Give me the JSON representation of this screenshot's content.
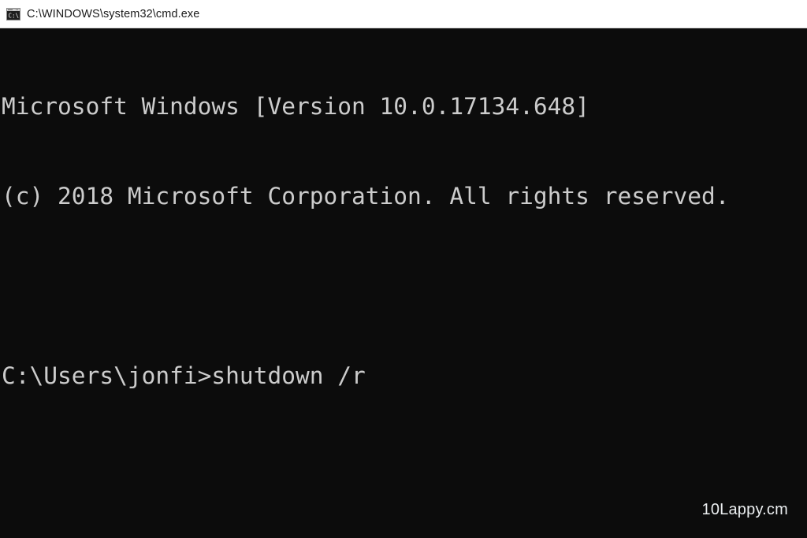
{
  "window": {
    "title": "C:\\WINDOWS\\system32\\cmd.exe",
    "icon": "cmd-console-icon",
    "titlebar_bg": "#ffffff",
    "titlebar_fg": "#1b1b1b",
    "console_bg": "#0c0c0c",
    "console_fg": "#cccccc"
  },
  "console": {
    "lines": [
      "Microsoft Windows [Version 10.0.17134.648]",
      "(c) 2018 Microsoft Corporation. All rights reserved.",
      "",
      "C:\\Users\\jonfi>shutdown /r"
    ],
    "banner_product": "Microsoft Windows",
    "banner_version": "10.0.17134.648",
    "copyright_year": "2018",
    "copyright_owner": "Microsoft Corporation",
    "copyright_notice": "All rights reserved.",
    "prompt_path": "C:\\Users\\jonfi",
    "prompt_symbol": ">",
    "current_command": "shutdown /r"
  },
  "watermark": {
    "text": "10Lappy.cm"
  }
}
